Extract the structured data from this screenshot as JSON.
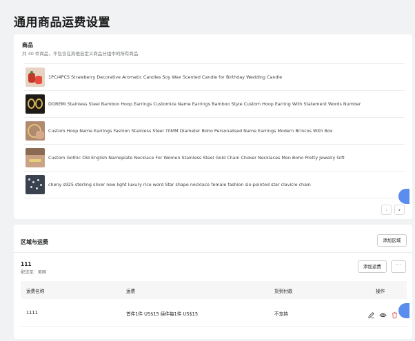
{
  "page": {
    "title": "通用商品运费设置"
  },
  "products": {
    "title": "商品",
    "subtitle": "共 40 件商品，不包含在其他自定义商品分组中的所有商品",
    "items": [
      {
        "name": "1PC/4PCS Strawberry Decorative Aromatic Candles Soy Wax Scented Candle for Birthday Wedding Candle"
      },
      {
        "name": "DOREMI Stainless Steel Bamboo Hoop Earrings Customize Name Earrings Bamboo Style Custom Hoop Earring With Statement Words Number"
      },
      {
        "name": "Custom Hoop Name Earrings Fashion Stainless Steel 70MM Diameter Boho Personalised Name Earrings Modern Brincos With Box"
      },
      {
        "name": "Custom Gothic Old English Nameplate Necklace For Women Stainless Steel Gold Chain Choker Necklaces Men Boho Pretty Jewelry Gift"
      },
      {
        "name": "cheny s925 sterling silver new light luxury rice word Star shape necklace female fashion six-pointed star clavicle chain"
      }
    ],
    "pager": {
      "prev": "‹",
      "next": "›"
    }
  },
  "zones": {
    "title": "区域与运费",
    "add_zone_label": "添加区域",
    "zone": {
      "name": "111",
      "ship_to": "配送至：美国",
      "add_rate_label": "添加运费",
      "more_label": "···",
      "columns": [
        "运费名称",
        "运费",
        "货到付款",
        "操作"
      ],
      "rows": [
        {
          "name": "1111",
          "rate": "首件1件 US$15  续件每1件 US$15",
          "cod": "不支持"
        }
      ]
    }
  },
  "colors": {
    "accent": "#5b8def",
    "delete": "#e0605e"
  },
  "icons": [
    "edit-icon",
    "view-icon",
    "delete-icon",
    "chevron-left-icon",
    "chevron-right-icon"
  ]
}
